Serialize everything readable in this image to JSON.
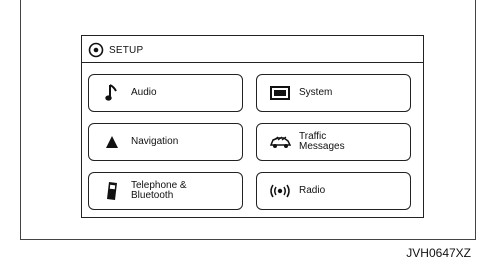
{
  "screen": {
    "title": "SETUP",
    "tiles": [
      {
        "label": "Audio",
        "icon": "music-note-icon"
      },
      {
        "label": "System",
        "icon": "display-icon"
      },
      {
        "label": "Navigation",
        "icon": "navigation-arrow-icon"
      },
      {
        "label": "Traffic\nMessages",
        "icon": "traffic-car-icon"
      },
      {
        "label": "Telephone &\nBluetooth",
        "icon": "phone-icon"
      },
      {
        "label": "Radio",
        "icon": "radio-waves-icon"
      }
    ]
  },
  "caption": "JVH0647XZ"
}
